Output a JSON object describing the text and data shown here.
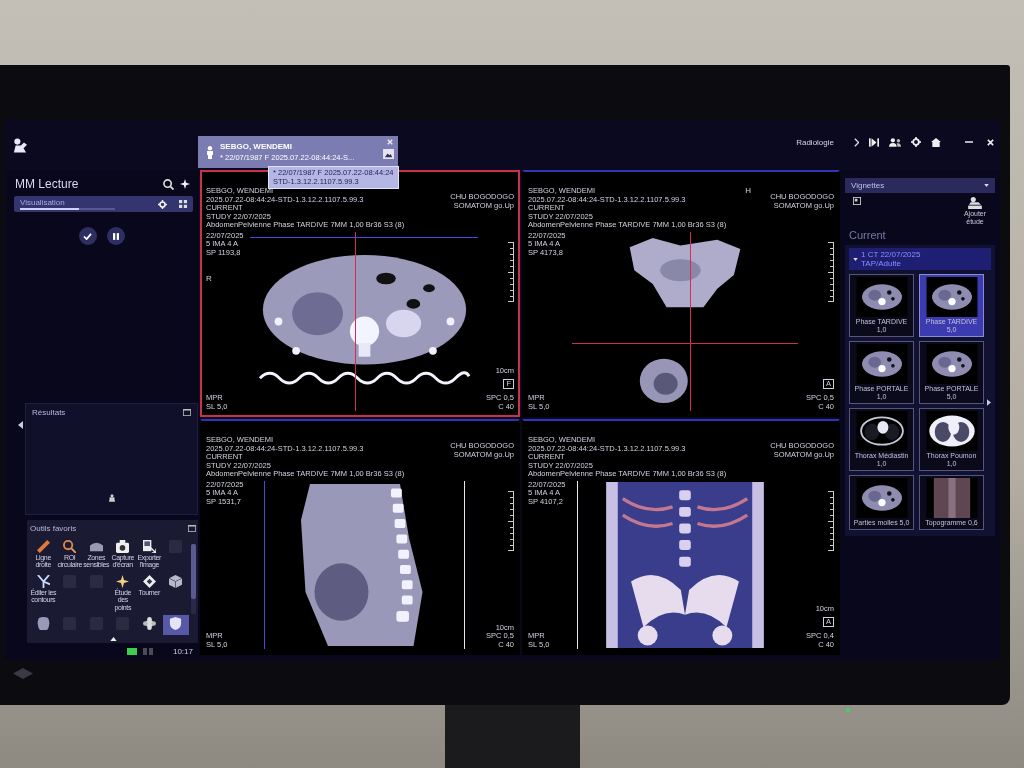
{
  "top_bar": {
    "patient_tab": {
      "name": "SEBGO, WENDEMI",
      "details": "* 22/07/1987 F 2025.07.22-08:44:24-S..."
    },
    "tooltip": [
      "* 22/07/1987 F 2025.07.22-08:44:24",
      "STD-1.3.12.2.1107.5.99.3"
    ],
    "workspace": "Radiologie"
  },
  "left_panel": {
    "title": "MM Lecture",
    "workflow_step": {
      "label": "Visualisation",
      "level": 0.62
    },
    "results": {
      "title": "Résultats"
    },
    "favorite_tools": {
      "title": "Outils favoris",
      "tools": [
        {
          "kind": "ruler",
          "label": "Ligne droite",
          "selected": false,
          "disabled": false
        },
        {
          "kind": "circle-roi",
          "label": "ROI circulaire",
          "selected": false,
          "disabled": false
        },
        {
          "kind": "slab",
          "label": "Zones sensibles",
          "selected": false,
          "disabled": false
        },
        {
          "kind": "camera",
          "label": "Capture d'écran",
          "selected": false,
          "disabled": false
        },
        {
          "kind": "export",
          "label": "Exporter l'image",
          "selected": false,
          "disabled": false
        },
        {
          "kind": "blank",
          "selected": false,
          "disabled": true
        },
        {
          "kind": "fork",
          "label": "Éditer les contours",
          "selected": false,
          "disabled": false
        },
        {
          "kind": "blank",
          "selected": false,
          "disabled": true
        },
        {
          "kind": "blank",
          "selected": false,
          "disabled": true
        },
        {
          "kind": "sparkle",
          "label": "Étude des points",
          "selected": false,
          "disabled": false
        },
        {
          "kind": "diamond",
          "label": "Tourner",
          "selected": false,
          "disabled": false
        },
        {
          "kind": "cube",
          "selected": false,
          "disabled": false
        },
        {
          "kind": "blob",
          "selected": false,
          "disabled": false
        },
        {
          "kind": "blank",
          "selected": false,
          "disabled": true
        },
        {
          "kind": "blank",
          "selected": false,
          "disabled": true
        },
        {
          "kind": "blank",
          "selected": false,
          "disabled": true
        },
        {
          "kind": "flower",
          "selected": false,
          "disabled": false
        },
        {
          "kind": "shield",
          "selected": true,
          "disabled": false
        }
      ]
    },
    "time": "10:17"
  },
  "viewports": [
    {
      "kind": "axial",
      "selected": true,
      "info": [
        "SEBGO, WENDEMI",
        "2025.07.22-08:44:24-STD-1.3.12.2.1107.5.99.3",
        "CURRENT",
        "STUDY 22/07/2025",
        "AbdomenPelvienne Phase TARDIVE 7MM 1,00 Br36 S3 (8)"
      ],
      "acquisition": [
        "22/07/2025",
        "5 IMA 4 A",
        "SP 1193,8"
      ],
      "site": [
        "CHU BOGODOGO",
        "SOMATOM go.Up"
      ],
      "side_marker": "R",
      "mode": [
        "MPR",
        "SL 5,0"
      ],
      "scale": "10cm",
      "orientation": "F",
      "window": [
        "SPC 0,5",
        "C 40"
      ]
    },
    {
      "kind": "coronal",
      "selected": false,
      "top_marker": "H",
      "info": [
        "SEBGO, WENDEMI",
        "2025.07.22-08:44:24-STD-1.3.12.2.1107.5.99.3",
        "CURRENT",
        "STUDY 22/07/2025",
        "AbdomenPelvienne Phase TARDIVE 7MM 1,00 Br36 S3 (8)"
      ],
      "acquisition": [
        "22/07/2025",
        "5 IMA 4 A",
        "SP 4173,8"
      ],
      "site": [
        "CHU BOGODOGO",
        "SOMATOM go.Up"
      ],
      "mode": [
        "MPR",
        "SL 5,0"
      ],
      "orientation": "A",
      "window": [
        "SPC 0,5",
        "C 40"
      ]
    },
    {
      "kind": "sagittal",
      "selected": false,
      "info": [
        "SEBGO, WENDEMI",
        "2025.07.22-08:44:24-STD-1.3.12.2.1107.5.99.3",
        "CURRENT",
        "STUDY 22/07/2025",
        "AbdomenPelvienne Phase TARDIVE 7MM 1,00 Br36 S3 (8)"
      ],
      "acquisition": [
        "22/07/2025",
        "5 IMA 4 A",
        "SP 1531,7"
      ],
      "site": [
        "CHU BOGODOGO",
        "SOMATOM go.Up"
      ],
      "mode": [
        "MPR",
        "SL 5,0"
      ],
      "scale": "10cm",
      "window": [
        "SPC 0,5",
        "C 40"
      ]
    },
    {
      "kind": "volume",
      "selected": false,
      "info": [
        "SEBGO, WENDEMI",
        "2025.07.22-08:44:24-STD-1.3.12.2.1107.5.99.3",
        "CURRENT",
        "STUDY 22/07/2025",
        "AbdomenPelvienne Phase TARDIVE 7MM 1,00 Br36 S3 (8)"
      ],
      "acquisition": [
        "22/07/2025",
        "5 IMA 4 A",
        "SP 4107,2"
      ],
      "site": [
        "CHU BOGODOGO",
        "SOMATOM go.Up"
      ],
      "mode": [
        "MPR",
        "SL 5,0"
      ],
      "scale": "10cm",
      "orientation": "A",
      "window": [
        "SPC 0,4",
        "C 40"
      ]
    }
  ],
  "right_panel": {
    "view_mode": "Vignettes",
    "load_button": "Ajouter étude",
    "section": "Current",
    "series_group": {
      "expanded": true,
      "title": "1 CT 22/07/2025",
      "subtitle": "TAP/Adulte"
    },
    "thumbnails": [
      {
        "kind": "abdomen",
        "caption": "Phase TARDIVE 1,0",
        "selected": false
      },
      {
        "kind": "abdomen",
        "caption": "Phase TARDIVE 5,0",
        "selected": true
      },
      {
        "kind": "abdomen",
        "caption": "Phase PORTALE 1,0",
        "selected": false
      },
      {
        "kind": "abdomen",
        "caption": "Phase PORTALE 5,0",
        "selected": false
      },
      {
        "kind": "chest",
        "caption": "Thorax Médiastin 1,0",
        "selected": false
      },
      {
        "kind": "lung",
        "caption": "Thorax Poumon 1,0",
        "selected": false
      },
      {
        "kind": "abdomen",
        "caption": "Parties molles 5,0",
        "selected": false
      },
      {
        "kind": "topogram",
        "caption": "Topogramme 0,6",
        "selected": false
      }
    ]
  }
}
